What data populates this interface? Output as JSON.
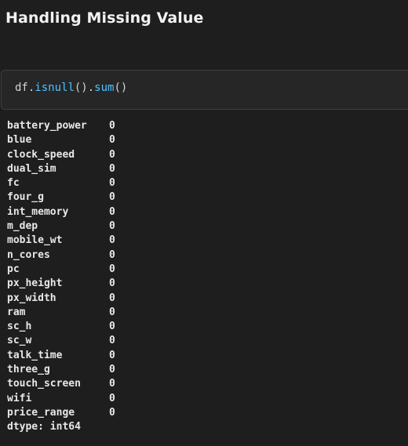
{
  "heading": "Handling Missing Value",
  "cell": {
    "code": {
      "var": "df",
      "dot1": ".",
      "fn1": "isnull",
      "paren1": "()",
      "dot2": ".",
      "fn2": "sum",
      "paren2": "()"
    }
  },
  "output": {
    "rows": [
      {
        "key": "battery_power",
        "value": "0"
      },
      {
        "key": "blue",
        "value": "0"
      },
      {
        "key": "clock_speed",
        "value": "0"
      },
      {
        "key": "dual_sim",
        "value": "0"
      },
      {
        "key": "fc",
        "value": "0"
      },
      {
        "key": "four_g",
        "value": "0"
      },
      {
        "key": "int_memory",
        "value": "0"
      },
      {
        "key": "m_dep",
        "value": "0"
      },
      {
        "key": "mobile_wt",
        "value": "0"
      },
      {
        "key": "n_cores",
        "value": "0"
      },
      {
        "key": "pc",
        "value": "0"
      },
      {
        "key": "px_height",
        "value": "0"
      },
      {
        "key": "px_width",
        "value": "0"
      },
      {
        "key": "ram",
        "value": "0"
      },
      {
        "key": "sc_h",
        "value": "0"
      },
      {
        "key": "sc_w",
        "value": "0"
      },
      {
        "key": "talk_time",
        "value": "0"
      },
      {
        "key": "three_g",
        "value": "0"
      },
      {
        "key": "touch_screen",
        "value": "0"
      },
      {
        "key": "wifi",
        "value": "0"
      },
      {
        "key": "price_range",
        "value": "0"
      }
    ],
    "dtype": "dtype: int64"
  }
}
